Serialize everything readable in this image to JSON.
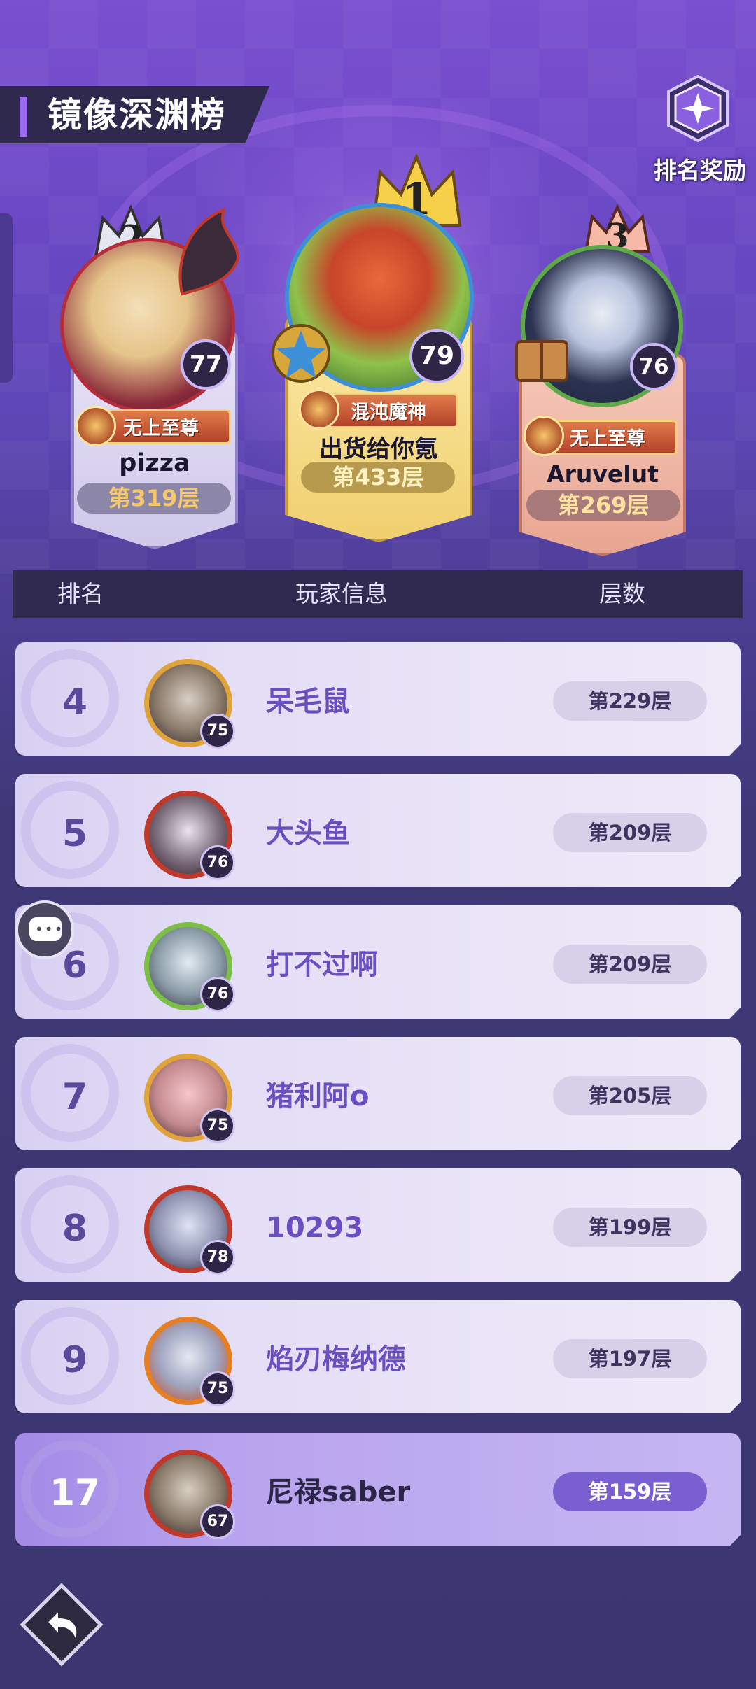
{
  "title": "镜像深渊榜",
  "reward_button": {
    "label": "排名奖励",
    "icon": "reward-trophy-icon"
  },
  "podium": [
    {
      "rank": "2",
      "level": "77",
      "badge_title": "无上至尊",
      "name": "pizza",
      "floor": "第319层",
      "card_color": "#ddd8f0",
      "accent": "#a79de0"
    },
    {
      "rank": "1",
      "level": "79",
      "badge_title": "混沌魔神",
      "name": "出货给你氪",
      "floor": "第433层",
      "card_color": "#f3d77c",
      "accent": "#d8a73c"
    },
    {
      "rank": "3",
      "level": "76",
      "badge_title": "无上至尊",
      "name": "Aruvelut",
      "floor": "第269层",
      "card_color": "#f0b7a6",
      "accent": "#d47f6a"
    }
  ],
  "table_header": {
    "rank": "排名",
    "player": "玩家信息",
    "floor": "层数"
  },
  "rows": [
    {
      "rank": "4",
      "name": "呆毛鼠",
      "level": "75",
      "floor": "第229层",
      "ring": "#e0a33a",
      "face": "#d9cfc4"
    },
    {
      "rank": "5",
      "name": "大头鱼",
      "level": "76",
      "floor": "第209层",
      "ring": "#c0392b",
      "face": "#e8e4ee"
    },
    {
      "rank": "6",
      "name": "打不过啊",
      "level": "76",
      "floor": "第209层",
      "ring": "#7cbf45",
      "face": "#e2ecf2"
    },
    {
      "rank": "7",
      "name": "猪利阿o",
      "level": "75",
      "floor": "第205层",
      "ring": "#e0a33a",
      "face": "#f4c7cc"
    },
    {
      "rank": "8",
      "name": "10293",
      "level": "78",
      "floor": "第199层",
      "ring": "#c0392b",
      "face": "#dfe3f4"
    },
    {
      "rank": "9",
      "name": "焰刃梅纳德",
      "level": "75",
      "floor": "第197层",
      "ring": "#e67e22",
      "face": "#e6e8f2"
    },
    {
      "rank": "17",
      "name": "尼禄saber",
      "level": "67",
      "floor": "第159层",
      "ring": "#c0392b",
      "face": "#d8cfc2",
      "self": true
    }
  ],
  "colors": {
    "accent_purple": "#6a4fc1",
    "header_bg": "#302a50",
    "self_row": "#b8a4ee"
  }
}
